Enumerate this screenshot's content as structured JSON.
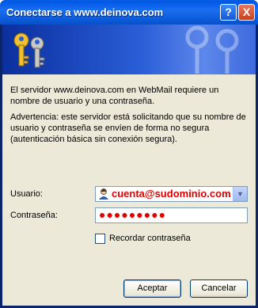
{
  "window": {
    "title": "Conectarse a www.deinova.com",
    "help_button": "?",
    "close_button": "X"
  },
  "banner": {
    "icon": "keys-icon"
  },
  "message": {
    "info": "El servidor www.deinova.com en WebMail requiere un nombre de usuario y una contraseña.",
    "warning": "Advertencia: este servidor está solicitando que su nombre de usuario y contraseña se envíen de forma no segura (autenticación básica sin conexión segura)."
  },
  "form": {
    "user_label": "Usuario:",
    "user_value": "cuenta@sudominio.com",
    "password_label": "Contraseña:",
    "password_value": "●●●●●●●●●",
    "remember_label": "Recordar contraseña",
    "remember_checked": false
  },
  "buttons": {
    "ok": "Aceptar",
    "cancel": "Cancelar"
  },
  "colors": {
    "accent": "#0a5de0",
    "value_text": "#e00000"
  }
}
